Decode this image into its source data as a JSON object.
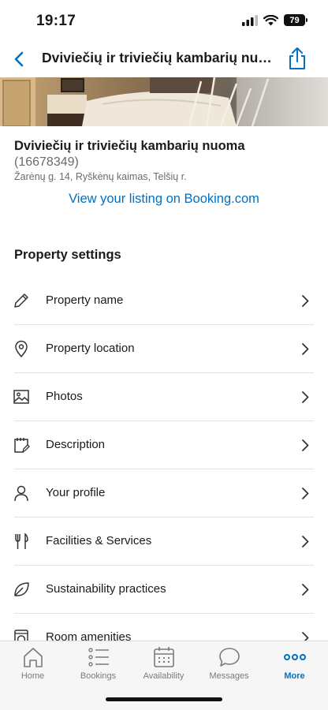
{
  "status_bar": {
    "time": "19:17",
    "battery": "79"
  },
  "nav": {
    "title": "Dviviečių ir triviečių kambarių nuoma"
  },
  "listing": {
    "name": "Dviviečių ir triviečių kambarių nuoma",
    "id": "(16678349)",
    "address": "Žarėnų g. 14, Ryškėnų kaimas, Telšių r.",
    "link_label": "View your listing on Booking.com"
  },
  "settings": {
    "title": "Property settings",
    "items": [
      {
        "label": "Property name",
        "icon": "pencil-icon"
      },
      {
        "label": "Property location",
        "icon": "location-pin-icon"
      },
      {
        "label": "Photos",
        "icon": "image-icon"
      },
      {
        "label": "Description",
        "icon": "notepad-icon"
      },
      {
        "label": "Your profile",
        "icon": "person-icon"
      },
      {
        "label": "Facilities & Services",
        "icon": "fork-knife-icon"
      },
      {
        "label": "Sustainability practices",
        "icon": "leaf-icon"
      },
      {
        "label": "Room amenities",
        "icon": "washing-machine-icon"
      }
    ]
  },
  "tabs": [
    {
      "label": "Home",
      "icon": "home-icon"
    },
    {
      "label": "Bookings",
      "icon": "list-icon"
    },
    {
      "label": "Availability",
      "icon": "calendar-icon"
    },
    {
      "label": "Messages",
      "icon": "chat-bubble-icon"
    },
    {
      "label": "More",
      "icon": "more-dots-icon",
      "active": true
    }
  ],
  "colors": {
    "accent": "#0071c2",
    "text": "#1a1a1a",
    "muted": "#6b6b6b"
  }
}
